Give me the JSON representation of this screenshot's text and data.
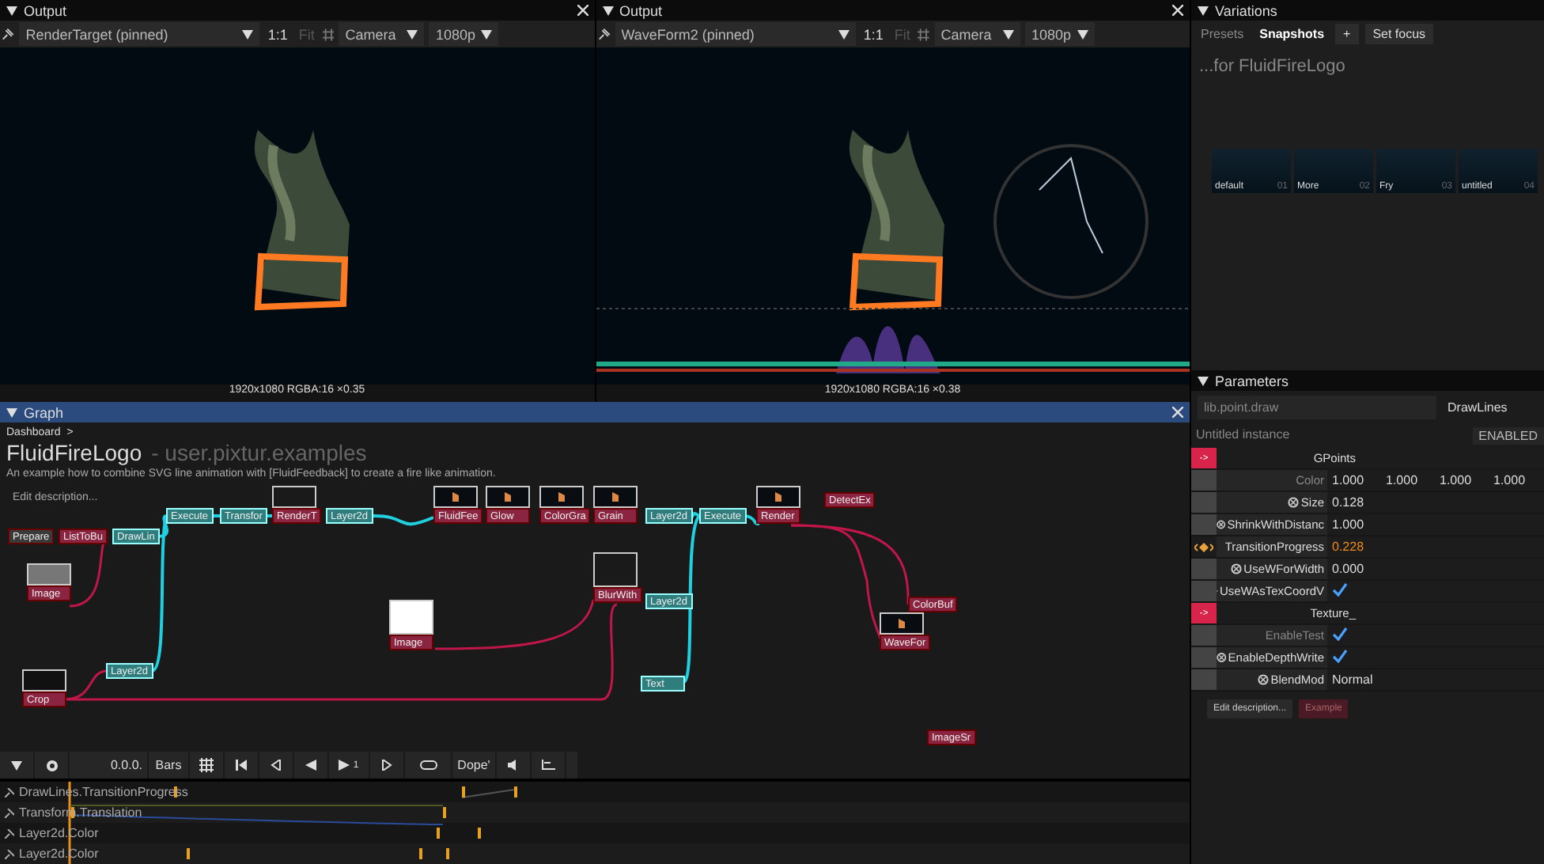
{
  "outputs": [
    {
      "title": "Output",
      "source": "RenderTarget (pinned)",
      "zoom": "1:1",
      "fit": "Fit",
      "camera": "Camera",
      "resolution": "1080p",
      "info": "1920x1080  RGBA:16  ×0.35",
      "waveform": false
    },
    {
      "title": "Output",
      "source": "WaveForm2 (pinned)",
      "zoom": "1:1",
      "fit": "Fit",
      "camera": "Camera",
      "resolution": "1080p",
      "info": "1920x1080  RGBA:16  ×0.38",
      "waveform": true
    }
  ],
  "graph": {
    "title": "Graph",
    "breadcrumb": "Dashboard",
    "breadcrumb_arrow": ">",
    "name": "FluidFireLogo",
    "namespace": "- user.pixtur.examples",
    "description": "An example how to combine SVG line animation with [FluidFeedback] to create a fire like animation.",
    "edit": "Edit description...",
    "nodes": [
      {
        "label": "Prepare",
        "kind": "plain"
      },
      {
        "label": "ListToBu",
        "kind": "texture"
      },
      {
        "label": "DrawLin",
        "kind": "command"
      },
      {
        "label": "Execute",
        "kind": "command"
      },
      {
        "label": "Transfor",
        "kind": "command"
      },
      {
        "label": "RenderT",
        "kind": "texture",
        "preview": {
          "kind": "blank"
        }
      },
      {
        "label": "Layer2d",
        "kind": "command"
      },
      {
        "label": "FluidFee",
        "kind": "texture",
        "preview": {
          "kind": "fire"
        }
      },
      {
        "label": "Glow",
        "kind": "texture",
        "preview": {
          "kind": "fire"
        }
      },
      {
        "label": "ColorGra",
        "kind": "texture",
        "preview": {
          "kind": "fire"
        }
      },
      {
        "label": "Grain",
        "kind": "texture",
        "preview": {
          "kind": "fire"
        }
      },
      {
        "label": "Layer2d",
        "kind": "command"
      },
      {
        "label": "Execute",
        "kind": "command"
      },
      {
        "label": "Render",
        "kind": "texture",
        "preview": {
          "kind": "fire"
        }
      },
      {
        "label": "DetectEx",
        "kind": "texture"
      },
      {
        "label": "Image",
        "kind": "texture",
        "preview": {
          "kind": "grey"
        }
      },
      {
        "label": "Layer2d",
        "kind": "command"
      },
      {
        "label": "Crop",
        "kind": "texture",
        "preview": {
          "kind": "logo"
        }
      },
      {
        "label": "Image",
        "kind": "texture",
        "preview": {
          "kind": "white"
        }
      },
      {
        "label": "BlurWith",
        "kind": "texture",
        "preview": {
          "kind": "blank"
        }
      },
      {
        "label": "Layer2d",
        "kind": "command"
      },
      {
        "label": "Text",
        "kind": "command"
      },
      {
        "label": "ColorBuf",
        "kind": "texture"
      },
      {
        "label": "WaveFor",
        "kind": "texture",
        "preview": {
          "kind": "fire"
        }
      },
      {
        "label": "ImageSr",
        "kind": "texture"
      }
    ]
  },
  "transport": {
    "time": "0.0.0.",
    "bars": "Bars",
    "play_speed": "1",
    "mode": "Dope'"
  },
  "tracks": [
    {
      "name": "DrawLines.TransitionProgress"
    },
    {
      "name": "Transform.Translation"
    },
    {
      "name": "Layer2d.Color"
    },
    {
      "name": "Layer2d.Color"
    }
  ],
  "variations": {
    "title": "Variations",
    "tabs": [
      {
        "label": "Presets",
        "selected": false
      },
      {
        "label": "Snapshots",
        "selected": true
      }
    ],
    "add": "+",
    "focus": "Set focus",
    "heading": "...for FluidFireLogo",
    "snapshots": [
      {
        "name": "default",
        "index": "01"
      },
      {
        "name": "More",
        "index": "02"
      },
      {
        "name": "Fry",
        "index": "03"
      },
      {
        "name": "untitled",
        "index": "04"
      }
    ]
  },
  "parameters": {
    "title": "Parameters",
    "path": "lib.point.draw",
    "op_name": "DrawLines",
    "instance": "Untitled instance",
    "status": "ENABLED",
    "rows": [
      {
        "kind": "group",
        "label": "GPoints",
        "marker": "->"
      },
      {
        "kind": "vector",
        "label": "Color",
        "values": [
          "1.000",
          "1.000",
          "1.000",
          "1.000"
        ],
        "overridden": false
      },
      {
        "kind": "number",
        "label": "Size",
        "value": "0.128",
        "overridden": true,
        "animated": false
      },
      {
        "kind": "number",
        "label": "ShrinkWithDistanc",
        "value": "1.000",
        "overridden": true,
        "animated": false
      },
      {
        "kind": "number",
        "label": "TransitionProgress",
        "value": "0.228",
        "overridden": false,
        "animated": true
      },
      {
        "kind": "number",
        "label": "UseWForWidth",
        "value": "0.000",
        "overridden": true,
        "animated": false
      },
      {
        "kind": "bool",
        "label": "UseWAsTexCoordV",
        "checked": true,
        "overridden": true
      },
      {
        "kind": "group",
        "label": "Texture_",
        "marker": "->"
      },
      {
        "kind": "bool",
        "label": "EnableTest",
        "checked": true,
        "overridden": false
      },
      {
        "kind": "bool",
        "label": "EnableDepthWrite",
        "checked": true,
        "overridden": true
      },
      {
        "kind": "enum",
        "label": "BlendMod",
        "value": "Normal",
        "overridden": true
      }
    ],
    "buttons": [
      {
        "label": "Edit description...",
        "kind": "plain"
      },
      {
        "label": "Example",
        "kind": "tag"
      }
    ]
  }
}
